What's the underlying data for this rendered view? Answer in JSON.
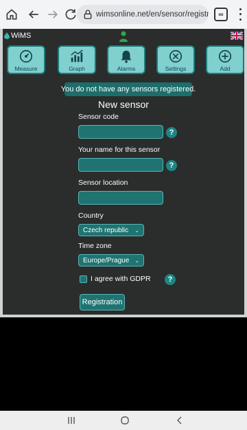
{
  "browser": {
    "url": "wimsonline.net/en/sensor/registration?_fid=",
    "tab_count": "∞"
  },
  "app": {
    "brand": "WiMS",
    "nav": [
      {
        "label": "Measure",
        "icon": "gauge-icon"
      },
      {
        "label": "Graph",
        "icon": "bar-chart-icon"
      },
      {
        "label": "Alarms",
        "icon": "bell-icon"
      },
      {
        "label": "Settings",
        "icon": "wrench-icon"
      },
      {
        "label": "Add",
        "icon": "plus-circle-icon"
      }
    ],
    "banner": "You do not have any sensors registered."
  },
  "form": {
    "title": "New sensor",
    "sensor_code_label": "Sensor code",
    "sensor_code_value": "",
    "name_label": "Your name for this sensor",
    "name_value": "",
    "location_label": "Sensor location",
    "location_value": "",
    "country_label": "Country",
    "country_value": "Czech republic",
    "timezone_label": "Time zone",
    "timezone_value": "Europe/Prague",
    "gdpr_label": "I agree with GDPR",
    "gdpr_checked": false,
    "submit_label": "Registration",
    "help_glyph": "?"
  },
  "colors": {
    "app_bg": "#2a2d2c",
    "teal_dark": "#1f7472",
    "nav_button": "#7fd0cf"
  }
}
